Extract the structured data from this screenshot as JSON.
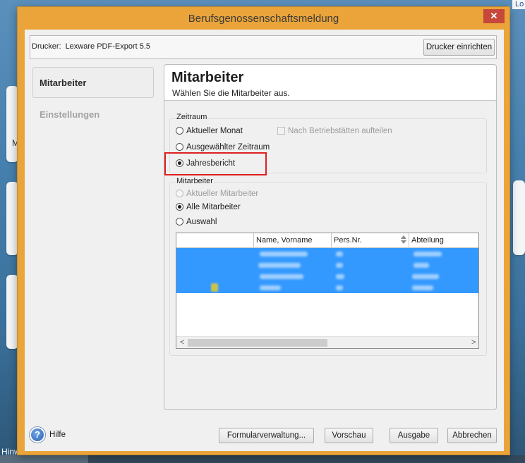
{
  "background_app": {
    "top_right_text": "Lo",
    "left_text": "M",
    "bottom_left_text": "Hinw"
  },
  "dialog": {
    "title": "Berufsgenossenschaftsmeldung",
    "close_glyph": "✕",
    "printer": {
      "label": "Drucker:",
      "value": "Lexware PDF-Export 5.5",
      "setup_button": "Drucker einrichten"
    },
    "nav": [
      {
        "label": "Mitarbeiter",
        "selected": true,
        "disabled": false
      },
      {
        "label": "Einstellungen",
        "selected": false,
        "disabled": true
      }
    ],
    "panel": {
      "title": "Mitarbeiter",
      "subtitle": "Wählen Sie die Mitarbeiter aus."
    },
    "zeitraum": {
      "legend": "Zeitraum",
      "options": [
        {
          "label": "Aktueller Monat",
          "checked": false,
          "disabled": false
        },
        {
          "label": "Ausgewählter Zeitraum",
          "checked": false,
          "disabled": false
        },
        {
          "label": "Jahresbericht",
          "checked": true,
          "disabled": false,
          "highlighted": true
        }
      ],
      "split_checkbox": {
        "label": "Nach Betriebstätten aufteilen",
        "checked": false,
        "disabled": true
      }
    },
    "mitarbeiter": {
      "legend": "Mitarbeiter",
      "options": [
        {
          "label": "Aktueller Mitarbeiter",
          "checked": false,
          "disabled": true
        },
        {
          "label": "Alle Mitarbeiter",
          "checked": true,
          "disabled": false
        },
        {
          "label": "Auswahl",
          "checked": false,
          "disabled": false
        }
      ],
      "table": {
        "columns": [
          "",
          "Name, Vorname",
          "Pers.Nr.",
          "Abteilung"
        ],
        "scroll_left": "<",
        "scroll_right": ">"
      }
    },
    "footer": {
      "help_glyph": "?",
      "help_label": "Hilfe",
      "buttons": {
        "forms": "Formularverwaltung...",
        "preview": "Vorschau",
        "output": "Ausgabe",
        "cancel": "Abbrechen"
      }
    }
  },
  "icons": {
    "close": "close-icon",
    "help": "help-icon",
    "sort": "sort-icon",
    "employee": "employee-icon",
    "scroll_left": "chevron-left-icon",
    "scroll_right": "chevron-right-icon"
  },
  "colors": {
    "dialog_frame": "#eaa43a",
    "close_button": "#c7473b",
    "selection": "#3399ff",
    "highlight_box": "#e02020",
    "content_bg": "#f0f0f0"
  }
}
